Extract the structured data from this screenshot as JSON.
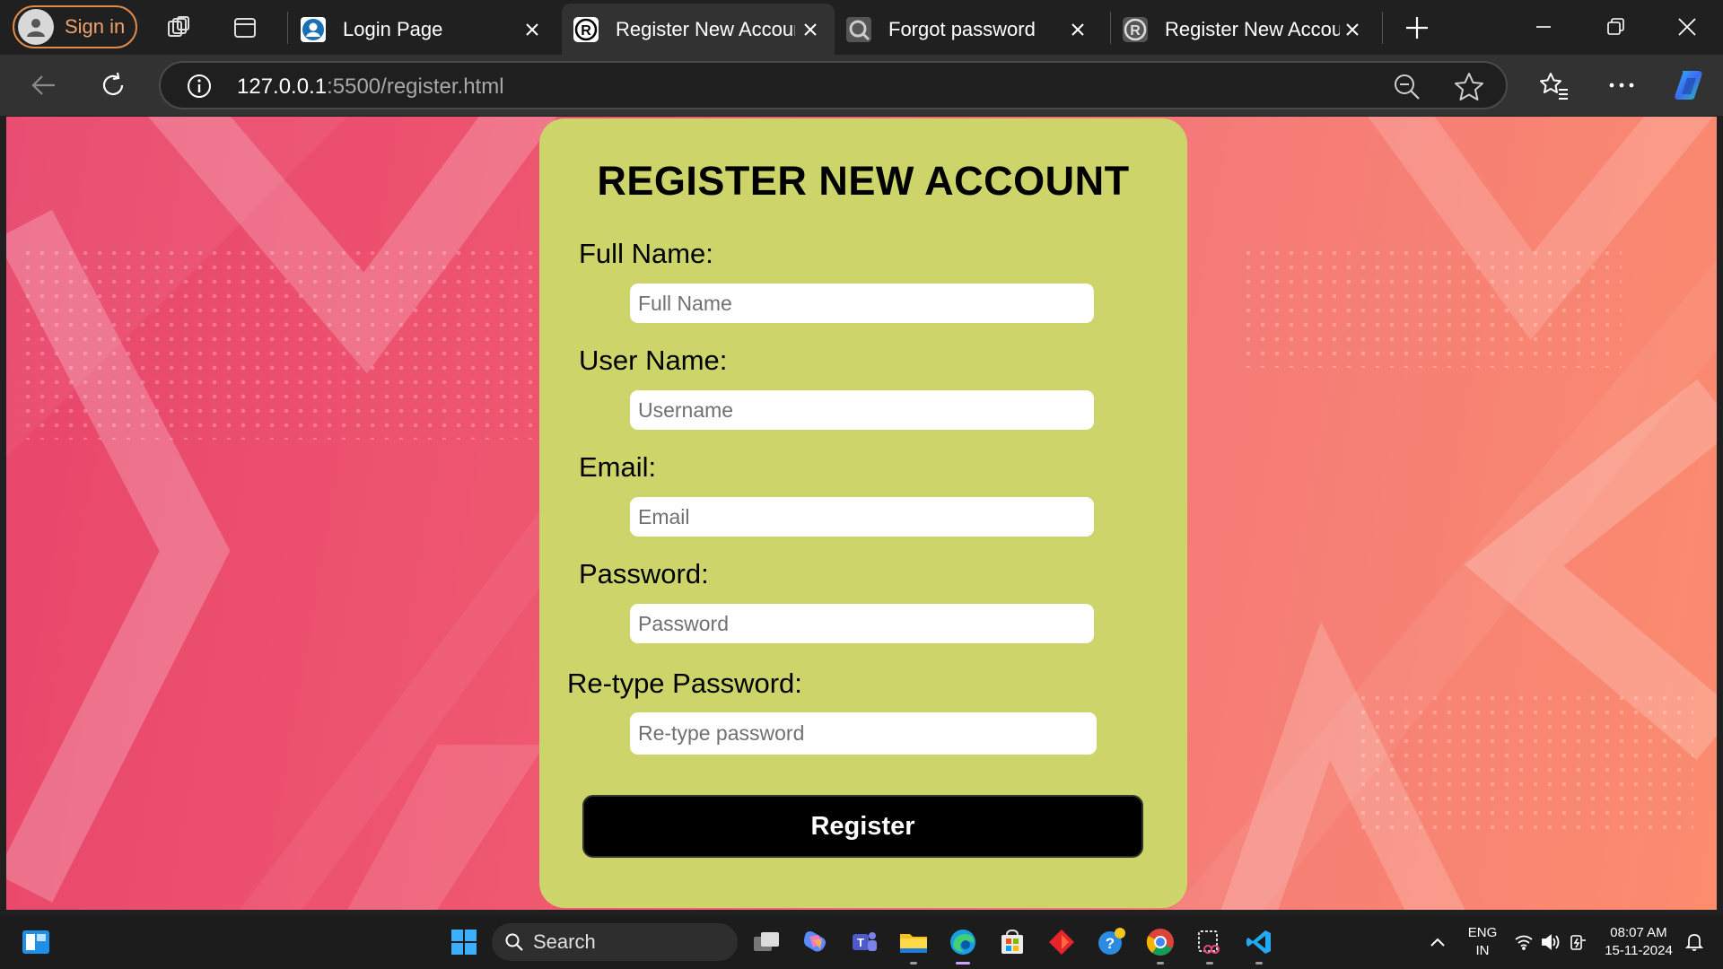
{
  "browser": {
    "signin_label": "Sign in",
    "tabs": [
      {
        "title": "Login Page",
        "icon": "user-favicon-icon",
        "active": false
      },
      {
        "title": "Register New Account",
        "icon": "r-logo-favicon-icon",
        "active": true
      },
      {
        "title": "Forgot password",
        "icon": "search-favicon-icon",
        "active": false
      },
      {
        "title": "Register New Account",
        "icon": "r-logo-favicon-icon",
        "active": false
      }
    ],
    "url_host": "127.0.0.1",
    "url_path": ":5500/register.html"
  },
  "form": {
    "heading": "REGISTER NEW ACCOUNT",
    "fields": [
      {
        "label": "Full Name:",
        "placeholder": "Full Name",
        "value": ""
      },
      {
        "label": "User Name:",
        "placeholder": "Username",
        "value": ""
      },
      {
        "label": "Email:",
        "placeholder": "Email",
        "value": ""
      },
      {
        "label": "Password:",
        "placeholder": "Password",
        "value": ""
      },
      {
        "label": "Re-type Password:",
        "placeholder": "Re-type password",
        "value": ""
      }
    ],
    "submit_label": "Register"
  },
  "taskbar": {
    "search_label": "Search",
    "language_line1": "ENG",
    "language_line2": "IN",
    "time": "08:07 AM",
    "date": "15-11-2024"
  },
  "colors": {
    "card": "#ccd46a",
    "bg_start": "#e8456b",
    "bg_end": "#fb8c6e",
    "button": "#000000"
  }
}
